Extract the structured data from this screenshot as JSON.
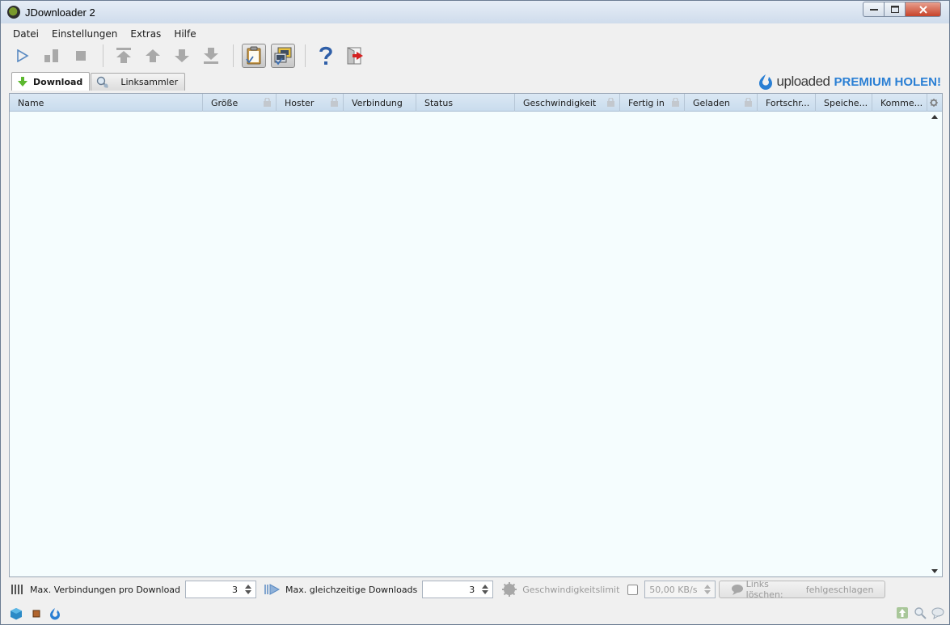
{
  "window": {
    "title": "JDownloader 2"
  },
  "menu": [
    "Datei",
    "Einstellungen",
    "Extras",
    "Hilfe"
  ],
  "tabs": [
    {
      "label": "Download",
      "active": true
    },
    {
      "label": "Linksammler",
      "active": false
    }
  ],
  "promo": {
    "brand": "uploaded",
    "cta": "PREMIUM HOLEN!"
  },
  "table": {
    "columns": [
      "Name",
      "Größe",
      "Hoster",
      "Verbindung",
      "Status",
      "Geschwindigkeit",
      "Fertig in",
      "Geladen",
      "Fortschr...",
      "Speiche...",
      "Komme..."
    ]
  },
  "bottom": {
    "max_connections_label": "Max. Verbindungen pro Download",
    "max_connections_value": "3",
    "max_downloads_label": "Max. gleichzeitige Downloads",
    "max_downloads_value": "3",
    "speed_limit_label": "Geschwindigkeitslimit",
    "speed_limit_value": "50,00 KB/s",
    "clear_links_label": "Links löschen:",
    "clear_links_value": "fehlgeschlagen"
  },
  "colors": {
    "accent": "#2a7fd4",
    "table_bg": "#f5fdfe",
    "header_bg": "#d3e2f0"
  }
}
